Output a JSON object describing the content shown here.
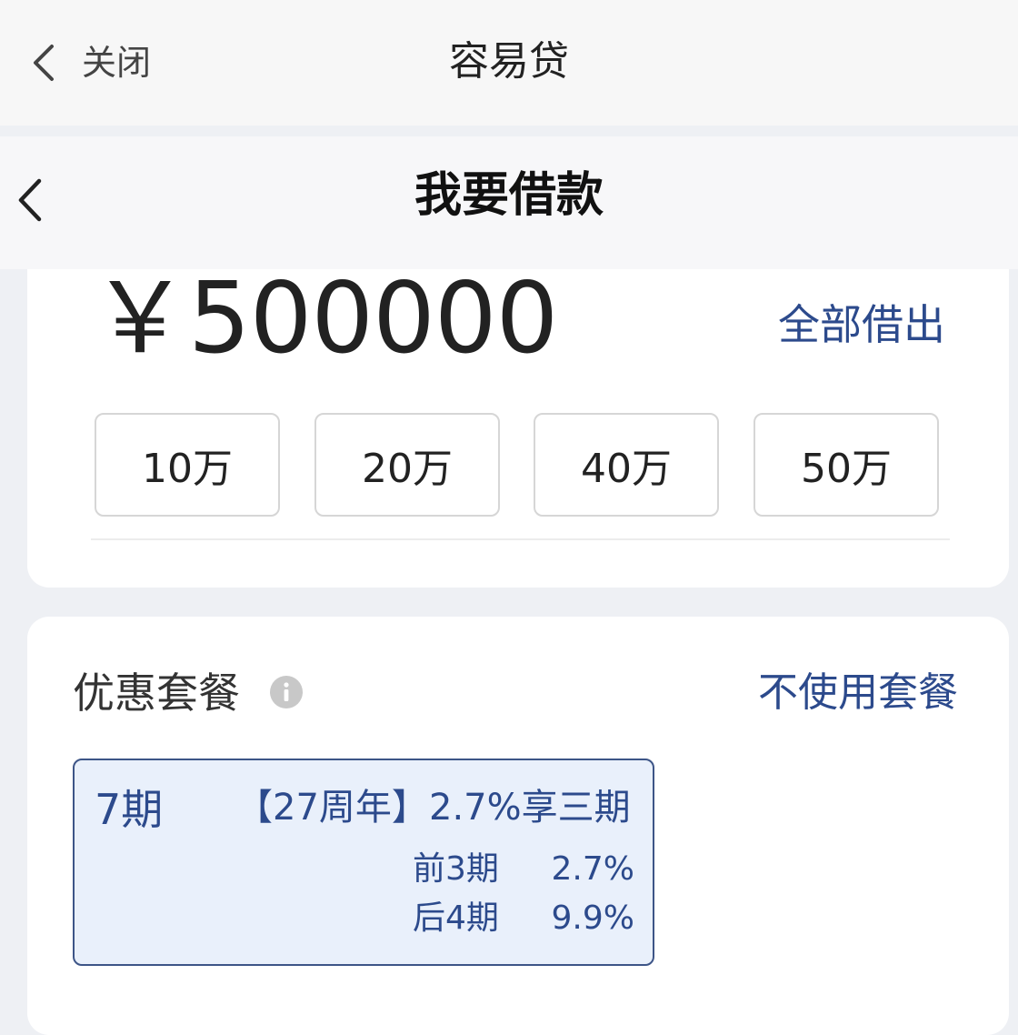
{
  "top_bar": {
    "close_label": "关闭",
    "title": "容易贷"
  },
  "page": {
    "title": "我要借款"
  },
  "amount": {
    "value": "￥500000",
    "borrow_all_label": "全部借出",
    "quick_options": [
      "10万",
      "20万",
      "40万",
      "50万"
    ]
  },
  "package": {
    "title": "优惠套餐",
    "no_package_label": "不使用套餐",
    "option": {
      "period": "7期",
      "tag": "【27周年】",
      "promo": "2.7%享三期",
      "lines": [
        {
          "label": "前3期",
          "value": "2.7%"
        },
        {
          "label": "后4期",
          "value": "9.9%"
        }
      ]
    }
  },
  "colors": {
    "accent": "#2c4a8c",
    "option_bg": "#e9f0fb",
    "page_bg": "#eef0f4"
  }
}
